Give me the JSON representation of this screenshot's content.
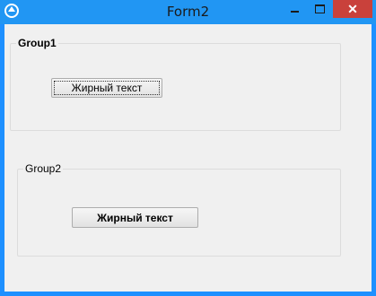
{
  "window": {
    "title": "Form2",
    "controls": {
      "minimize_icon": "minimize-icon",
      "maximize_icon": "maximize-icon",
      "close_icon": "close-icon",
      "close_glyph": "✕"
    }
  },
  "group1": {
    "label": "Group1",
    "button_label": "Жирный текст"
  },
  "group2": {
    "label": "Group2",
    "button_label": "Жирный текст"
  },
  "colors": {
    "titlebar": "#2196f3",
    "close_button": "#c9413b",
    "client_background": "#f0f0f0"
  }
}
